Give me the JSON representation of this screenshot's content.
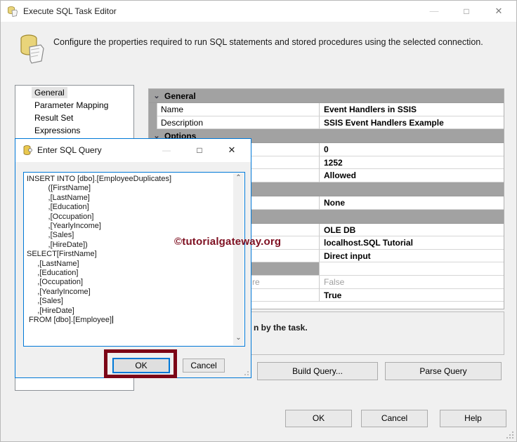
{
  "window": {
    "title": "Execute SQL Task Editor",
    "description": "Configure the properties required to run SQL statements and stored procedures using the selected connection."
  },
  "icons": {
    "minimize": "—",
    "maximize": "□",
    "close": "✕",
    "chevron_down": "⌄",
    "scroll_up": "⌃",
    "scroll_down": "⌄"
  },
  "nav": {
    "items": [
      {
        "label": "General",
        "selected": true
      },
      {
        "label": "Parameter Mapping",
        "selected": false
      },
      {
        "label": "Result Set",
        "selected": false
      },
      {
        "label": "Expressions",
        "selected": false
      }
    ]
  },
  "grid": {
    "rows": [
      {
        "type": "group",
        "label": "General"
      },
      {
        "type": "item",
        "label": "Name",
        "value": "Event Handlers in SSIS"
      },
      {
        "type": "item",
        "label": "Description",
        "value": "SSIS Event Handlers Example"
      },
      {
        "type": "group",
        "label": "Options"
      },
      {
        "type": "item",
        "label": "",
        "value": "0"
      },
      {
        "type": "item",
        "label": "",
        "value": "1252"
      },
      {
        "type": "item",
        "label": "",
        "value": "Allowed"
      },
      {
        "type": "group",
        "label": ""
      },
      {
        "type": "item",
        "label": "",
        "value": "None"
      },
      {
        "type": "group",
        "label": ""
      },
      {
        "type": "item",
        "label": "",
        "value": "OLE DB"
      },
      {
        "type": "item",
        "label": "",
        "value": "localhost.SQL Tutorial"
      },
      {
        "type": "item",
        "label": "",
        "value": "Direct input"
      },
      {
        "type": "item-selected",
        "label": "",
        "value": ""
      },
      {
        "type": "item-disabled",
        "label": "re",
        "value": "False"
      },
      {
        "type": "item",
        "label": "",
        "value": "True"
      }
    ],
    "description_text": "n by the task."
  },
  "buttons": {
    "build_query": "Build Query...",
    "parse_query": "Parse Query",
    "ok": "OK",
    "cancel": "Cancel",
    "help": "Help"
  },
  "popup": {
    "title": "Enter SQL Query",
    "sql_lines": [
      "INSERT INTO [dbo].[EmployeeDuplicates]",
      "          ([FirstName]",
      "          ,[LastName]",
      "          ,[Education]",
      "          ,[Occupation]",
      "          ,[YearlyIncome]",
      "          ,[Sales]",
      "          ,[HireDate])",
      "SELECT[FirstName]",
      "     ,[LastName]",
      "     ,[Education]",
      "     ,[Occupation]",
      "     ,[YearlyIncome]",
      "     ,[Sales]",
      "     ,[HireDate]",
      " FROM [dbo].[Employee]"
    ],
    "ok": "OK",
    "cancel": "Cancel"
  },
  "watermark": {
    "text": "©tutorialgateway.org",
    "color": "#7e1021"
  },
  "annotation": {
    "color": "#7c0517"
  }
}
